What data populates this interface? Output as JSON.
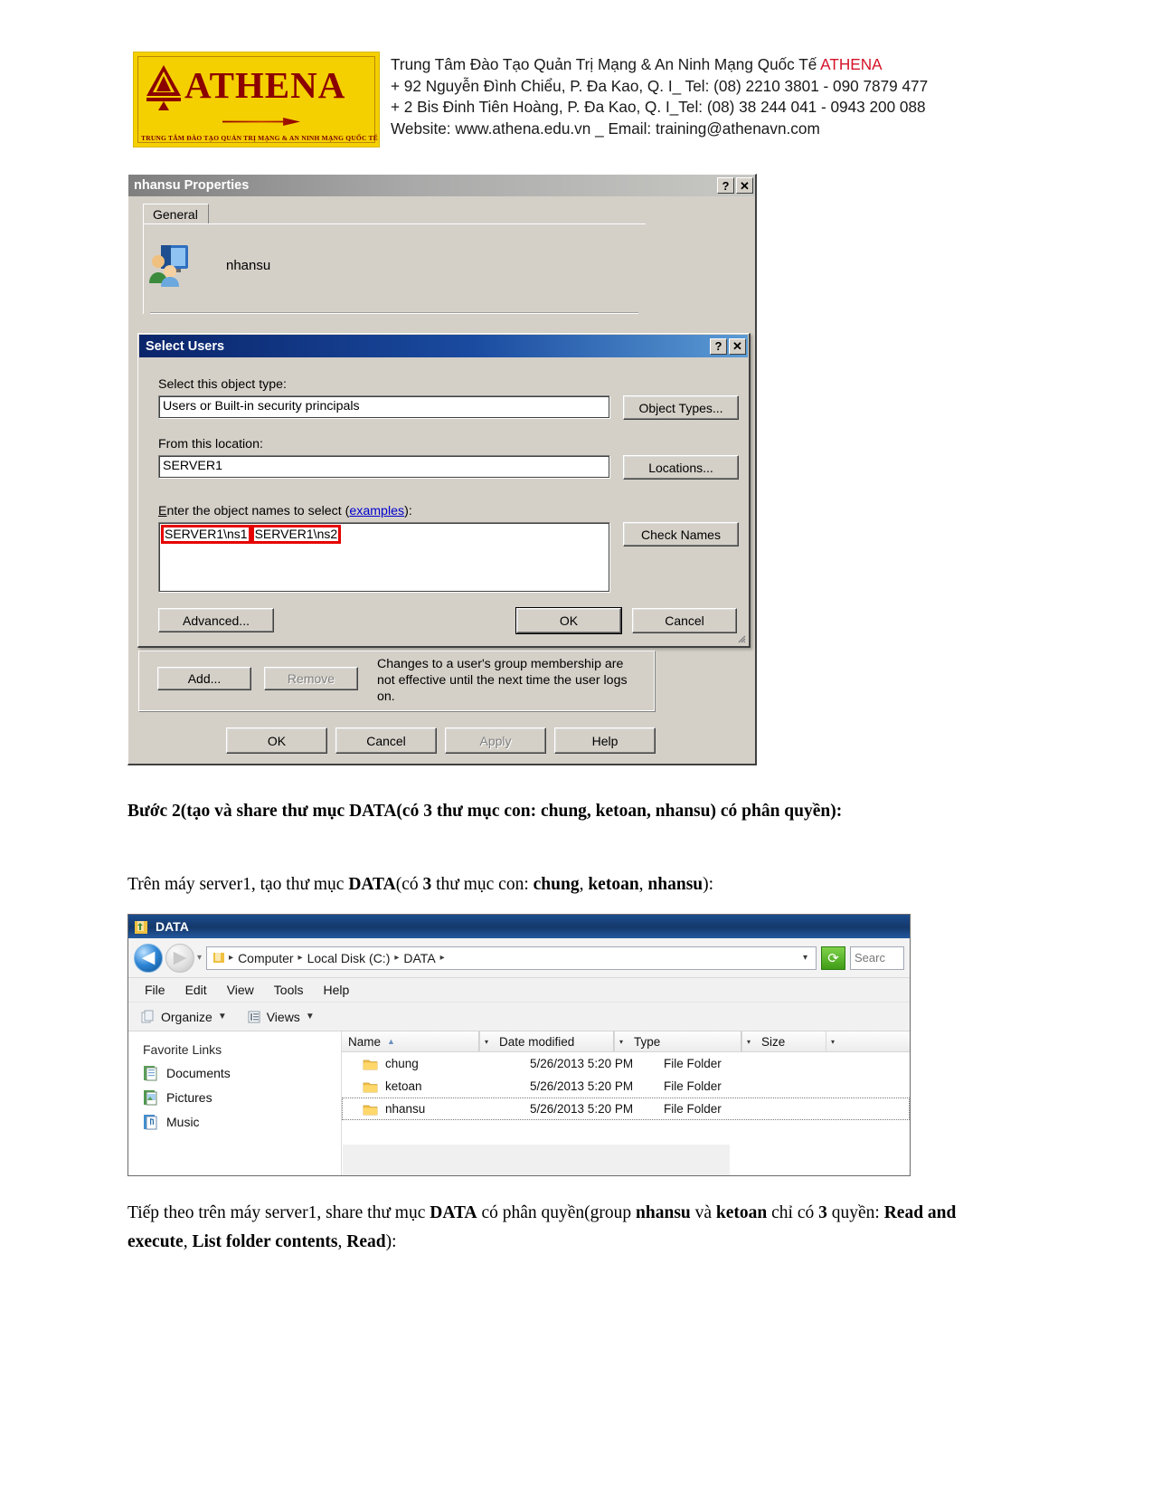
{
  "letterhead": {
    "logo_word": "ATHENA",
    "logo_tagline": "TRUNG TÂM ĐÀO TẠO QUẢN TRỊ MẠNG & AN NINH MẠNG QUỐC TẾ",
    "line1_main": "Trung Tâm Đào Tạo Quản Trị Mạng & An Ninh Mạng Quốc Tế ",
    "line1_brand": "ATHENA",
    "line2": "+ 92 Nguyễn Đình Chiểu, P. Đa Kao, Q. I_ Tel: (08) 2210 3801 -  090 7879 477",
    "line3": "+ 2 Bis Đinh Tiên Hoàng, P. Đa Kao, Q. I_Tel: (08) 38 244 041 - 0943 200 088",
    "line4": "Website: www.athena.edu.vn    _     Email: training@athenavn.com"
  },
  "properties_dialog": {
    "title": "nhansu Properties",
    "help_button": "?",
    "close_button": "✕",
    "tab_general": "General",
    "object_name": "nhansu",
    "membership": {
      "add_label": "Add...",
      "remove_label": "Remove",
      "note": "Changes to a user's group membership are not effective until the next time the user logs on."
    },
    "buttons": {
      "ok": "OK",
      "cancel": "Cancel",
      "apply": "Apply",
      "help": "Help"
    }
  },
  "select_users_dialog": {
    "title": "Select Users",
    "help_button": "?",
    "close_button": "✕",
    "object_type_label": "Select this object type:",
    "object_type_value": "Users or Built-in security principals",
    "object_types_button": "Object Types...",
    "location_label": "From this location:",
    "location_value": "SERVER1",
    "locations_button": "Locations...",
    "names_label_prefix": "nter the object names to select (",
    "names_label_accesskey": "E",
    "names_label_examples": "examples",
    "names_label_suffix": "):",
    "name_entry_1": "SERVER1\\ns1",
    "name_entry_2": "SERVER1\\ns2",
    "check_names_button": "Check Names",
    "advanced_button": "Advanced...",
    "ok_button": "OK",
    "cancel_button": "Cancel",
    "highlight_color": "#e60000"
  },
  "paragraphs": {
    "p1_a": "Bước 2(tạo và share thư mục DATA(có 3 thư mục con: chung, ketoan, nhansu) có phân quyền):",
    "p2_pre": "Trên máy server1, tạo thư mục ",
    "p2_b1": "DATA",
    "p2_mid": "(có ",
    "p2_b2": "3",
    "p2_mid2": " thư mục con: ",
    "p2_b3": "chung",
    "p2_sep1": ", ",
    "p2_b4": "ketoan",
    "p2_sep2": ", ",
    "p2_b5": "nhansu",
    "p2_end": "):",
    "p3_pre": "Tiếp theo trên máy server1, share thư mục ",
    "p3_b1": "DATA",
    "p3_mid": " có phân quyền(group ",
    "p3_b2": "nhansu",
    "p3_mid2": " và ",
    "p3_b3": "ketoan",
    "p3_mid3": " chỉ có ",
    "p3_b4": "3",
    "p3_mid4": " quyền: ",
    "p3_b5": "Read and execute",
    "p3_sep1": ", ",
    "p3_b6": "List folder contents",
    "p3_sep2": ", ",
    "p3_b7": "Read",
    "p3_end": "):"
  },
  "explorer": {
    "title": "DATA",
    "nav": {
      "back": "◀",
      "forward": "▶",
      "recent_caret": "▾",
      "dropdown_caret": "▾",
      "refresh": "⟳",
      "search_placeholder": "Searc"
    },
    "breadcrumbs": [
      "Computer",
      "Local Disk (C:)",
      "DATA"
    ],
    "crumb_sep": "▸",
    "menu": [
      "File",
      "Edit",
      "View",
      "Tools",
      "Help"
    ],
    "toolbar": {
      "organize": "Organize",
      "views": "Views",
      "caret": "▼"
    },
    "sidebar": {
      "header": "Favorite Links",
      "items": [
        {
          "label": "Documents"
        },
        {
          "label": "Pictures"
        },
        {
          "label": "Music"
        }
      ]
    },
    "columns": [
      {
        "label": "Name",
        "sort": "▲"
      },
      {
        "label": "Date modified",
        "sort": ""
      },
      {
        "label": "Type",
        "sort": ""
      },
      {
        "label": "Size",
        "sort": ""
      }
    ],
    "col_drop_caret": "▾",
    "rows": [
      {
        "name": "chung",
        "date": "5/26/2013 5:20 PM",
        "type": "File Folder",
        "size": ""
      },
      {
        "name": "ketoan",
        "date": "5/26/2013 5:20 PM",
        "type": "File Folder",
        "size": ""
      },
      {
        "name": "nhansu",
        "date": "5/26/2013 5:20 PM",
        "type": "File Folder",
        "size": ""
      }
    ]
  }
}
